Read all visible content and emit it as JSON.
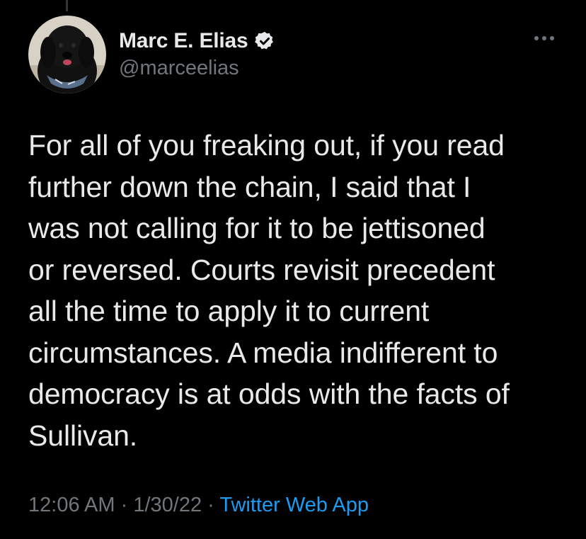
{
  "tweet": {
    "author": {
      "display_name": "Marc E. Elias",
      "handle": "@marceelias",
      "verified": true,
      "avatar_icon": "dog-avatar"
    },
    "more_icon": "more-horizontal-icon",
    "text": "For all of you freaking out, if you read\nfurther down the chain, I said that I\nwas not calling for it to be jettisoned\nor reversed. Courts revisit precedent\nall the time to apply it to current\ncircumstances. A media indifferent to\ndemocracy is at odds with the facts of\nSullivan.",
    "time": "12:06 AM",
    "separator": "·",
    "date": "1/30/22",
    "source": "Twitter Web App"
  },
  "colors": {
    "background": "#000000",
    "primary_text": "#e7e9ea",
    "secondary_text": "#71767b",
    "accent": "#1d9bf0"
  }
}
